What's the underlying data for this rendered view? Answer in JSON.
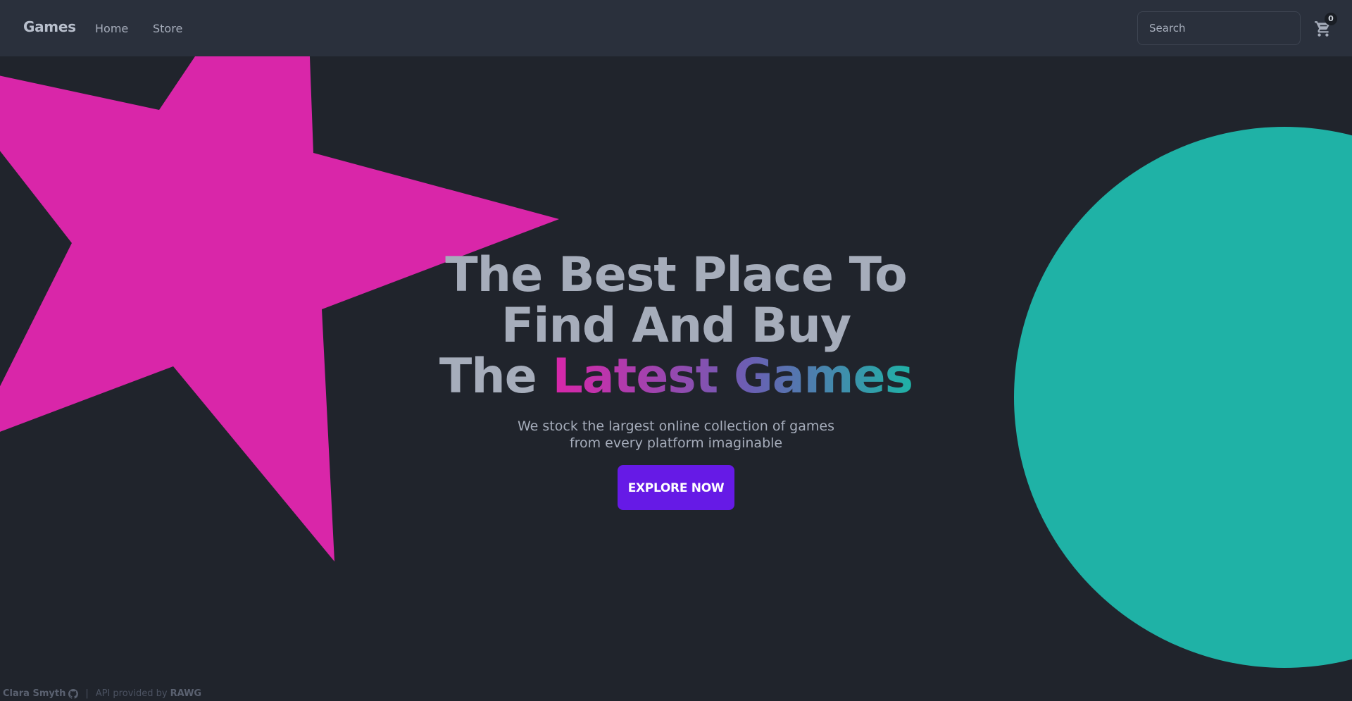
{
  "nav": {
    "brand": "Games",
    "links": [
      {
        "label": "Home"
      },
      {
        "label": "Store"
      }
    ],
    "search_placeholder": "Search",
    "cart_count": "0"
  },
  "hero": {
    "line1": "The Best Place To",
    "line2": "Find And Buy",
    "line3_prefix": "The",
    "line3_highlight": "Latest Games",
    "subtitle_line1": "We stock the largest online collection of games",
    "subtitle_line2": "from every platform imaginable",
    "cta_label": "EXPLORE NOW"
  },
  "footer": {
    "author": "Clara Smyth",
    "separator": "|",
    "api_prefix": "API provided by",
    "api_name": "RAWG"
  },
  "colors": {
    "background": "#20242c",
    "navbar": "#2a303c",
    "star": "#d926a9",
    "circle": "#1fb2a6",
    "cta": "#661ae6",
    "text": "#a6adbb"
  },
  "icons": {
    "cart": "shopping-cart-icon",
    "github": "github-icon"
  }
}
